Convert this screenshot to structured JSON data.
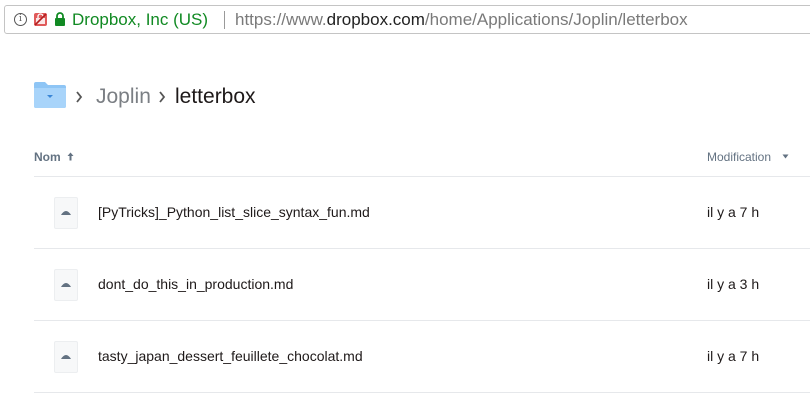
{
  "address_bar": {
    "organization": "Dropbox, Inc (US)",
    "url_prefix": "https://www.",
    "url_host": "dropbox.com",
    "url_path": "/home/Applications/Joplin/letterbox",
    "icons": [
      "info-icon",
      "mixed-content-icon",
      "lock-icon"
    ],
    "secure_color": "#118a23"
  },
  "breadcrumb": {
    "root_icon": "folder-icon",
    "items": [
      "Joplin",
      "letterbox"
    ]
  },
  "table": {
    "columns": {
      "name": "Nom",
      "modified": "Modification"
    },
    "rows": [
      {
        "name": "[PyTricks]_Python_list_slice_syntax_fun.md",
        "modified": "il y a 7 h",
        "icon": "markdown-file-icon"
      },
      {
        "name": "dont_do_this_in_production.md",
        "modified": "il y a 3 h",
        "icon": "markdown-file-icon"
      },
      {
        "name": "tasty_japan_dessert_feuillete_chocolat.md",
        "modified": "il y a 7 h",
        "icon": "markdown-file-icon"
      }
    ]
  },
  "colors": {
    "folder": "#8ec5f5",
    "header_text": "#637282",
    "divider": "#e6e8eb"
  }
}
